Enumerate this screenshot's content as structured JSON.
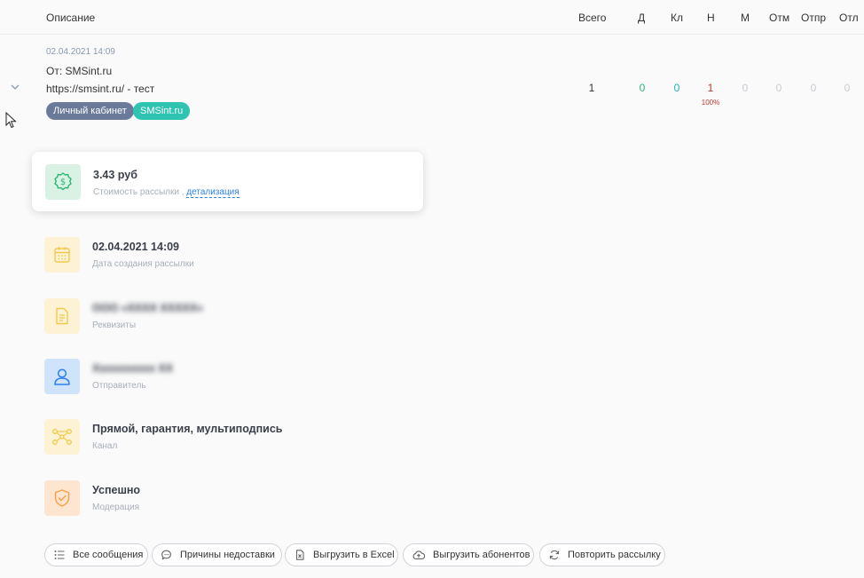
{
  "header": {
    "description": "Описание",
    "total": "Всего",
    "delivered": "Д",
    "clicked": "Кл",
    "not_delivered": "Н",
    "m": "М",
    "cancelled": "Отм",
    "sent": "Отпр",
    "deferred": "Отл"
  },
  "row": {
    "date": "02.04.2021 14:09",
    "from": "От: SMSint.ru",
    "description": "https://smsint.ru/ - тест",
    "tags": [
      "Личный кабинет",
      "SMSint.ru"
    ],
    "stats": {
      "total": "1",
      "delivered": "0",
      "clicked": "0",
      "not_delivered": "1",
      "not_delivered_percent": "100%",
      "m": "0",
      "cancelled": "0",
      "sent": "0",
      "deferred": "0"
    }
  },
  "details": {
    "cost": {
      "value": "3.43 руб",
      "label": "Стоимость рассылки ,",
      "link": "детализация"
    },
    "created": {
      "value": "02.04.2021 14:09",
      "label": "Дата создания рассылки"
    },
    "requisites": {
      "value": "ООО «ХХХХ ХХХХХ»",
      "label": "Реквизиты"
    },
    "sender": {
      "value": "Хххххххххх ХХ",
      "label": "Отправитель"
    },
    "channel": {
      "value": "Прямой, гарантия, мультиподпись",
      "label": "Канал"
    },
    "moderation": {
      "value": "Успешно",
      "label": "Модерация"
    }
  },
  "actions": {
    "all_messages": "Все сообщения",
    "failure_reasons": "Причины недоставки",
    "export_excel": "Выгрузить в Excel",
    "export_subscribers": "Выгрузить абонентов",
    "repeat_mailing": "Повторить рассылку"
  },
  "colors": {
    "green": "#2ab673",
    "teal": "#20b2a8",
    "red": "#c0392b",
    "muted": "#c8ccd2",
    "link": "#2d7ff0"
  }
}
